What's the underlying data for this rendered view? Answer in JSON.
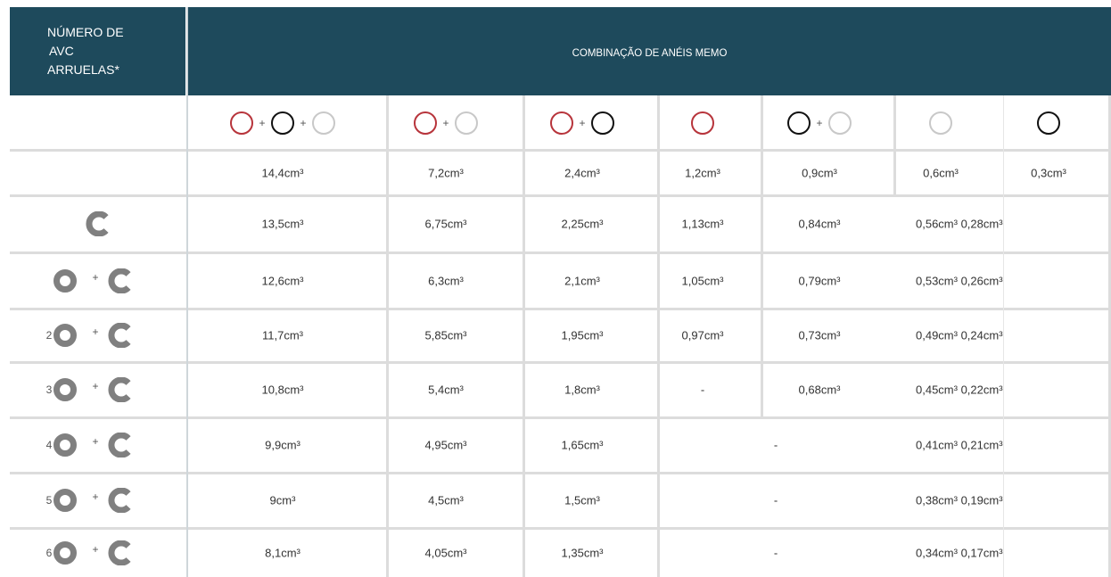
{
  "header": {
    "left_lines": [
      "NÚMERO DE",
      "AVC",
      "ARRUELAS*"
    ],
    "right": "COMBINAÇÃO DE ANÉIS MEMO"
  },
  "colors": {
    "header_bg": "#1e4a5c",
    "ring_red": "#b7343b",
    "ring_black": "#111111",
    "ring_grey": "#c8c8c8",
    "washer_grey": "#808080"
  },
  "plus_sign": "+",
  "dash": "-",
  "ring_combos": [
    [
      "red",
      "black",
      "grey"
    ],
    [
      "red",
      "grey"
    ],
    [
      "red",
      "black"
    ],
    [
      "red"
    ],
    [
      "black",
      "grey"
    ],
    [
      "grey"
    ],
    [
      "black"
    ]
  ],
  "base_row": [
    "14,4cm³",
    "7,2cm³",
    "2,4cm³",
    "1,2cm³",
    "0,9cm³",
    "0,6cm³",
    "0,3cm³"
  ],
  "rows": [
    {
      "washer_count": "",
      "rings": false,
      "values": [
        "13,5cm³",
        "6,75cm³",
        "2,25cm³",
        "1,13cm³",
        "0,84cm³"
      ],
      "last_pair": "0,56cm³ 0,28cm³"
    },
    {
      "washer_count": "",
      "rings": true,
      "values": [
        "12,6cm³",
        "6,3cm³",
        "2,1cm³",
        "1,05cm³",
        "0,79cm³"
      ],
      "last_pair": "0,53cm³ 0,26cm³"
    },
    {
      "washer_count": "2",
      "rings": true,
      "values": [
        "11,7cm³",
        "5,85cm³",
        "1,95cm³",
        "0,97cm³",
        "0,73cm³"
      ],
      "last_pair": "0,49cm³ 0,24cm³"
    },
    {
      "washer_count": "3",
      "rings": true,
      "values": [
        "10,8cm³",
        "5,4cm³",
        "1,8cm³",
        "-",
        "0,68cm³"
      ],
      "last_pair": "0,45cm³ 0,22cm³"
    },
    {
      "washer_count": "4",
      "rings": true,
      "values": [
        "9,9cm³",
        "4,95cm³",
        "1,65cm³"
      ],
      "merged": "-",
      "last_pair": "0,41cm³ 0,21cm³"
    },
    {
      "washer_count": "5",
      "rings": true,
      "values": [
        "9cm³",
        "4,5cm³",
        "1,5cm³"
      ],
      "merged": "-",
      "last_pair": "0,38cm³ 0,19cm³"
    },
    {
      "washer_count": "6",
      "rings": true,
      "values": [
        "8,1cm³",
        "4,05cm³",
        "1,35cm³"
      ],
      "merged": "-",
      "last_pair": "0,34cm³ 0,17cm³"
    }
  ]
}
